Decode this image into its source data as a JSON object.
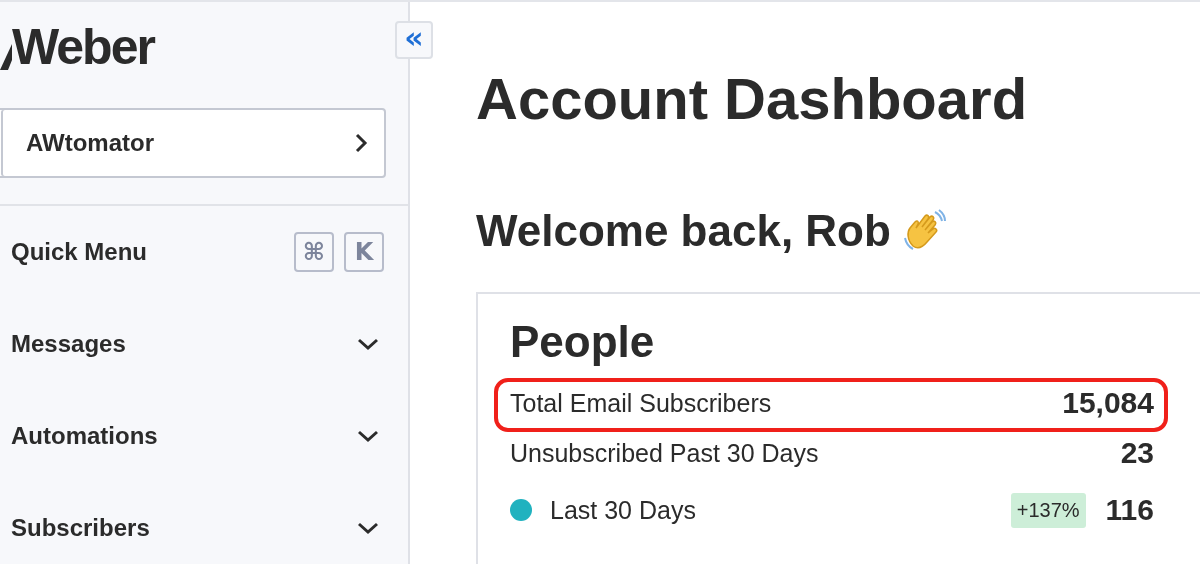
{
  "sidebar": {
    "logo": "Weber",
    "account": {
      "name": "AWtomator"
    },
    "items": [
      {
        "label": "Quick Menu",
        "kind": "shortcut",
        "keys": [
          "⌘",
          "K"
        ]
      },
      {
        "label": "Messages",
        "kind": "dropdown",
        "expanded": false
      },
      {
        "label": "Automations",
        "kind": "dropdown",
        "expanded": false
      },
      {
        "label": "Subscribers",
        "kind": "dropdown",
        "expanded": false
      }
    ]
  },
  "collapse_button": {
    "label": "«"
  },
  "page": {
    "title": "Account Dashboard",
    "welcome": "Welcome back, Rob"
  },
  "people_card": {
    "title": "People",
    "stats": [
      {
        "label": "Total Email Subscribers",
        "value": "15,084",
        "highlighted": true
      },
      {
        "label": "Unsubscribed Past 30 Days",
        "value": "23",
        "highlighted": false
      },
      {
        "label": "Last 30 Days",
        "value": "116",
        "badge": "+137%",
        "color": "#20b2bf",
        "highlighted": false
      }
    ]
  }
}
